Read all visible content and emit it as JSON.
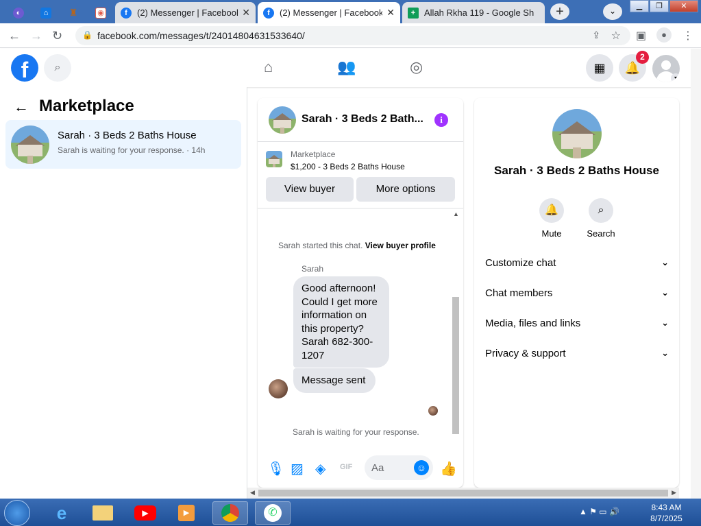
{
  "browser": {
    "tabs": [
      {
        "title": "",
        "icon": "browser-app-icon",
        "color": "#6d5bd0"
      },
      {
        "title": "",
        "icon": "zillow-icon",
        "color": "#1277e1"
      },
      {
        "title": "",
        "icon": "app-icon",
        "color": "#b5651d"
      },
      {
        "title": "",
        "icon": "app-icon-2",
        "color": "#e05c4a"
      },
      {
        "title": "(2) Messenger | Facebook",
        "icon": "facebook-icon",
        "color": "#1877f2"
      },
      {
        "title": "(2) Messenger | Facebook",
        "icon": "facebook-icon",
        "color": "#1877f2"
      },
      {
        "title": "Allah Rkha 119 - Google Sh",
        "icon": "google-sheets-icon",
        "color": "#0f9d58"
      }
    ],
    "url": "facebook.com/messages/t/24014804631533640/"
  },
  "fb": {
    "notification_count": "2",
    "brand_color": "#1877f2"
  },
  "left_panel": {
    "title": "Marketplace",
    "conversation": {
      "name": "Sarah · 3 Beds 2 Baths House",
      "preview": "Sarah is waiting for your response. · 14h"
    }
  },
  "chat": {
    "header_name": "Sarah · 3 Beds 2 Bath...",
    "marketplace_label": "Marketplace",
    "listing": "$1,200 - 3 Beds 2 Baths House",
    "view_buyer": "View buyer",
    "more_options": "More options",
    "system_started": "Sarah started this chat.",
    "view_buyer_profile": "View buyer profile",
    "sender": "Sarah",
    "message1": "Good afternoon! Could I get more information on this property? Sarah 682-300-1207",
    "message2": "Message sent",
    "waiting": "Sarah is waiting for your response.",
    "input_placeholder": "Aa"
  },
  "info_panel": {
    "name": "Sarah · 3 Beds 2 Baths House",
    "mute": "Mute",
    "search": "Search",
    "sections": [
      "Customize chat",
      "Chat members",
      "Media, files and links",
      "Privacy & support"
    ]
  },
  "taskbar": {
    "time": "8:43 AM",
    "date": "8/7/2025"
  }
}
